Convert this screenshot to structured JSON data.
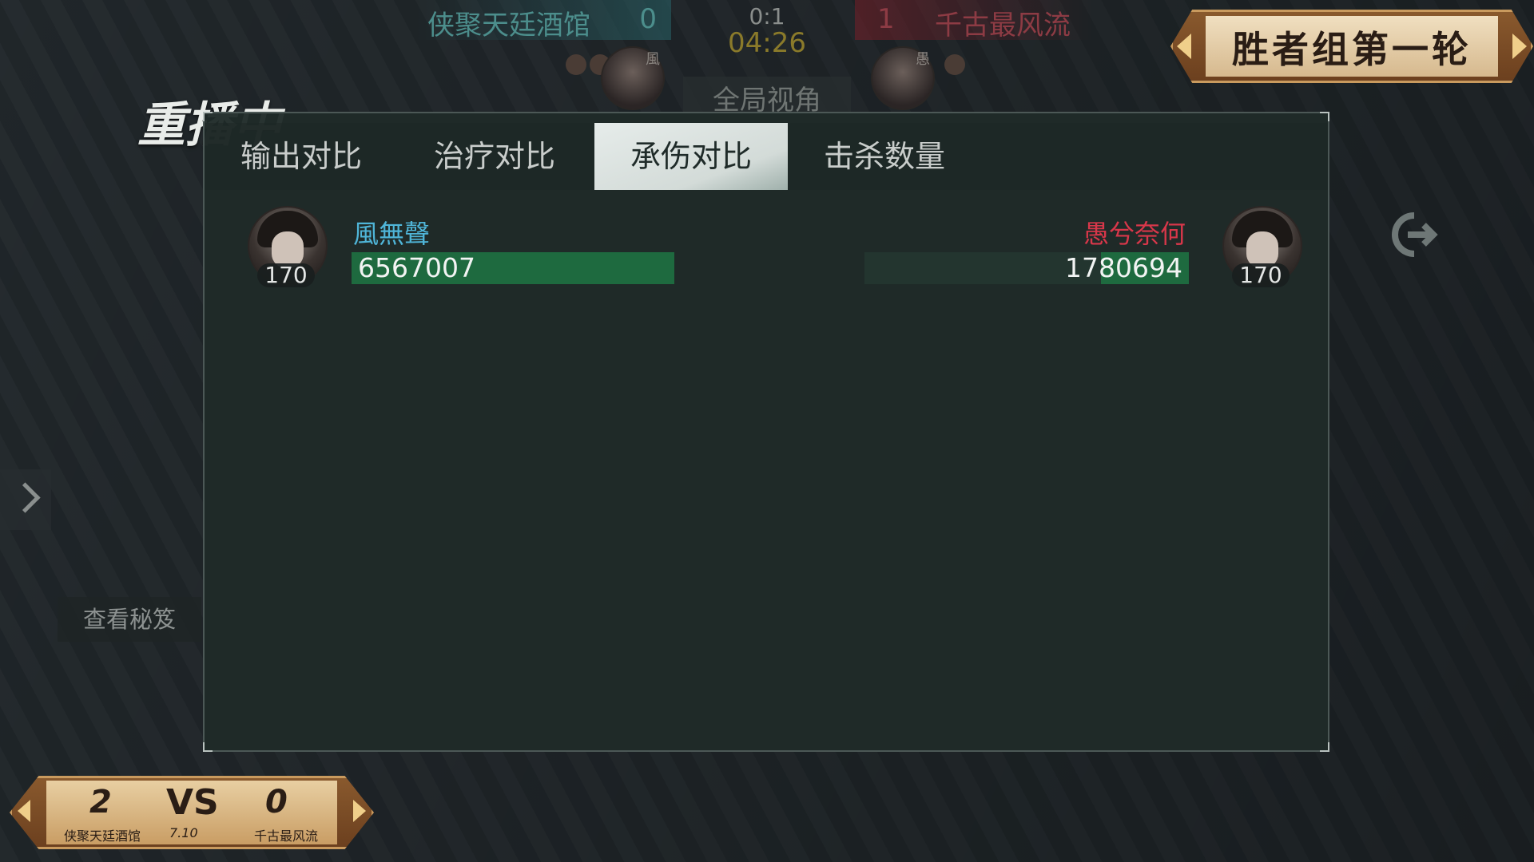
{
  "scoreboard": {
    "left_team": "侠聚天廷酒馆",
    "left_score": "0",
    "match_score": "0:1",
    "timer": "04:26",
    "right_score": "1",
    "right_team": "千古最风流",
    "left_avatar_tag": "風",
    "right_avatar_tag": "愚",
    "overview_label": "全局视角"
  },
  "round_banner": {
    "label": "胜者组第一轮"
  },
  "replay_label": "重播中",
  "side": {
    "secret_button": "查看秘笈"
  },
  "panel": {
    "tabs": [
      {
        "label": "输出对比",
        "active": false
      },
      {
        "label": "治疗对比",
        "active": false
      },
      {
        "label": "承伤对比",
        "active": true
      },
      {
        "label": "击杀数量",
        "active": false
      }
    ],
    "left_player": {
      "name": "風無聲",
      "level": "170",
      "value": "6567007",
      "value_num": 6567007,
      "name_color": "#4fb5d8"
    },
    "right_player": {
      "name": "愚兮奈何",
      "level": "170",
      "value": "1780694",
      "value_num": 1780694,
      "name_color": "#d8374a"
    }
  },
  "series": {
    "left_score": "2",
    "vs": "VS",
    "right_score": "0",
    "date": "7.10",
    "left_team": "侠聚天廷酒馆",
    "right_team": "千古最风流"
  },
  "colors": {
    "bar_fill": "#1e6a3f",
    "accent_gold": "#c99a5e"
  },
  "icons": {
    "exit": "exit-icon",
    "side_toggle": "chevron-right-icon"
  }
}
